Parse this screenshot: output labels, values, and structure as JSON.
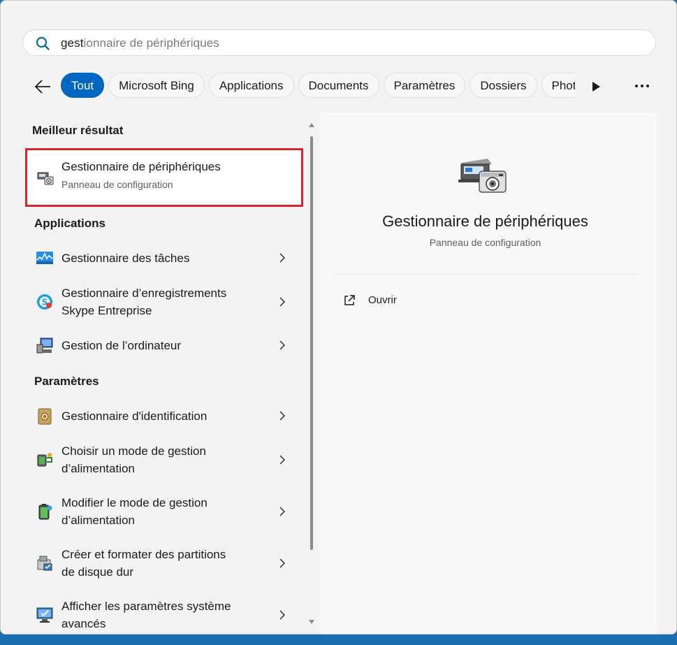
{
  "search": {
    "typed": "gest",
    "rest": "ionnaire de périphériques"
  },
  "filters": [
    "Tout",
    "Microsoft Bing",
    "Applications",
    "Documents",
    "Paramètres",
    "Dossiers",
    "Photos"
  ],
  "sections": {
    "best": "Meilleur résultat",
    "apps": "Applications",
    "settings": "Paramètres"
  },
  "best_result": {
    "title": "Gestionnaire de périphériques",
    "subtitle": "Panneau de configuration"
  },
  "apps": [
    {
      "line1": "Gestionnaire des tâches",
      "line2": ""
    },
    {
      "line1": "Gestionnaire d’enregistrements",
      "line2": "Skype Entreprise"
    },
    {
      "line1": "Gestion de l’ordinateur",
      "line2": ""
    }
  ],
  "settings": [
    {
      "line1": "Gestionnaire d'identification",
      "line2": ""
    },
    {
      "line1": "Choisir un mode de gestion",
      "line2": "d’alimentation"
    },
    {
      "line1": "Modifier le mode de gestion",
      "line2": "d’alimentation"
    },
    {
      "line1": "Créer et formater des partitions",
      "line2": "de disque dur"
    },
    {
      "line1": "Afficher les paramètres système",
      "line2": "avancés"
    }
  ],
  "detail": {
    "title": "Gestionnaire de périphériques",
    "subtitle": "Panneau de configuration",
    "open_label": "Ouvrir"
  },
  "colors": {
    "accent": "#0067c0",
    "highlight": "#d9252e"
  }
}
